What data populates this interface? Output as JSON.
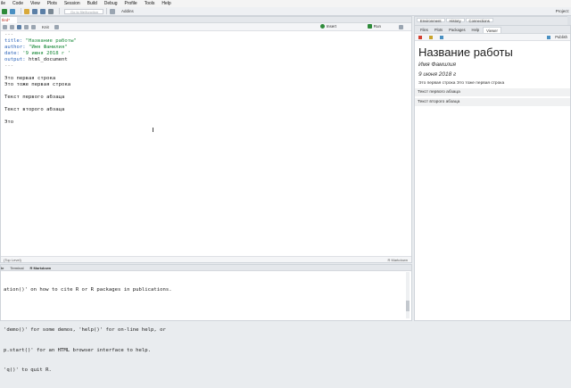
{
  "menubar": {
    "items": [
      "ile",
      "Code",
      "View",
      "Plots",
      "Session",
      "Build",
      "Debug",
      "Profile",
      "Tools",
      "Help"
    ]
  },
  "toolbar": {
    "goto_placeholder": "Go to file/function",
    "addins_label": "Addins",
    "project_label": "Project:"
  },
  "editor": {
    "tab_label": "tled*",
    "knit_label": "Knit",
    "insert_label": "Insert",
    "run_label": "Run",
    "status_left": "(Top Level)",
    "status_right": "R Markdown",
    "lines": [
      {
        "kind": "dash",
        "text": "---"
      },
      {
        "kind": "kv",
        "key": "title: ",
        "value": "\"Название работы\""
      },
      {
        "kind": "kv",
        "key": "author: ",
        "value": "\"Имя Фамилия\""
      },
      {
        "kind": "kv",
        "key": "date: ",
        "value": "'9 июня 2018 г '"
      },
      {
        "kind": "kv",
        "key": "output: ",
        "value": "html_document",
        "plain": true
      },
      {
        "kind": "dash",
        "text": "---"
      },
      {
        "kind": "blank",
        "text": ""
      },
      {
        "kind": "text",
        "text": "Это первая строка"
      },
      {
        "kind": "text",
        "text": "Это тоже первая строка"
      },
      {
        "kind": "blank",
        "text": ""
      },
      {
        "kind": "text",
        "text": "Текст первого абзаца"
      },
      {
        "kind": "blank",
        "text": ""
      },
      {
        "kind": "text",
        "text": "Текст второго абзаца"
      },
      {
        "kind": "blank",
        "text": ""
      },
      {
        "kind": "text",
        "text": "Это"
      }
    ]
  },
  "console": {
    "tabs": [
      "le",
      "Terminal",
      "R Markdown"
    ],
    "lines": [
      "ation()' on how to cite R or R packages in publications.",
      "",
      "'demo()' for some demos, 'help()' for on-line help, or",
      "p.start()' for an HTML browser interface to help.",
      "'q()' to quit R."
    ]
  },
  "right_pane": {
    "env_tabs": [
      "Environment",
      "History",
      "Connections"
    ],
    "viewer_tabs": [
      "Files",
      "Plots",
      "Packages",
      "Help",
      "Viewer"
    ],
    "publish_label": "Publish"
  },
  "viewer_doc": {
    "title": "Название работы",
    "author": "Имя Фамилия",
    "date": "9 июня 2018 г",
    "p1": "Это первая строка Это тоже первая строка",
    "p2": "Текст первого абзаца",
    "p3": "Текст второго абзаца"
  },
  "colors": {
    "yaml_key": "#2b63b8",
    "yaml_value": "#1a8a3a",
    "run_green": "#2e8b3a"
  }
}
